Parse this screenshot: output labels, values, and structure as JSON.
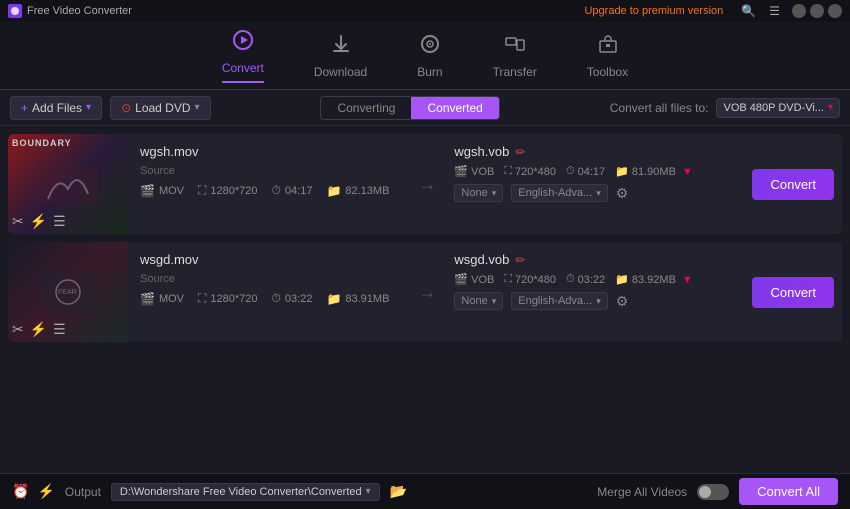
{
  "app": {
    "title": "Free Video Converter",
    "upgrade_label": "Upgrade to premium version"
  },
  "nav": {
    "items": [
      {
        "id": "convert",
        "label": "Convert",
        "icon": "⊙",
        "active": true
      },
      {
        "id": "download",
        "label": "Download",
        "icon": "⬇",
        "active": false
      },
      {
        "id": "burn",
        "label": "Burn",
        "icon": "⊕",
        "active": false
      },
      {
        "id": "transfer",
        "label": "Transfer",
        "icon": "⇌",
        "active": false
      },
      {
        "id": "toolbox",
        "label": "Toolbox",
        "icon": "▦",
        "active": false
      }
    ]
  },
  "toolbar": {
    "add_files": "Add Files",
    "load_dvd": "Load DVD",
    "tab_converting": "Converting",
    "tab_converted": "Converted",
    "convert_all_label": "Convert all files to:",
    "format_value": "VOB 480P DVD-Vi..."
  },
  "files": [
    {
      "source_name": "wgsh.mov",
      "source_format": "MOV",
      "source_res": "1280*720",
      "source_dur": "04:17",
      "source_size": "82.13MB",
      "target_name": "wgsh.vob",
      "target_format": "VOB",
      "target_res": "720*480",
      "target_dur": "04:17",
      "target_size": "81.90MB",
      "subtitle": "None",
      "audio": "English-Adva...",
      "thumb_class": "thumb-1",
      "thumb_label": "BOUNDARY"
    },
    {
      "source_name": "wsgd.mov",
      "source_format": "MOV",
      "source_res": "1280*720",
      "source_dur": "03:22",
      "source_size": "83.91MB",
      "target_name": "wsgd.vob",
      "target_format": "VOB",
      "target_res": "720*480",
      "target_dur": "03:22",
      "target_size": "83.92MB",
      "subtitle": "None",
      "audio": "English-Adva...",
      "thumb_class": "thumb-2",
      "thumb_label": ""
    }
  ],
  "bottom": {
    "output_label": "Output",
    "output_path": "D:\\Wondershare Free Video Converter\\Converted",
    "merge_label": "Merge All Videos",
    "convert_all": "Convert All"
  },
  "buttons": {
    "convert": "Convert"
  }
}
